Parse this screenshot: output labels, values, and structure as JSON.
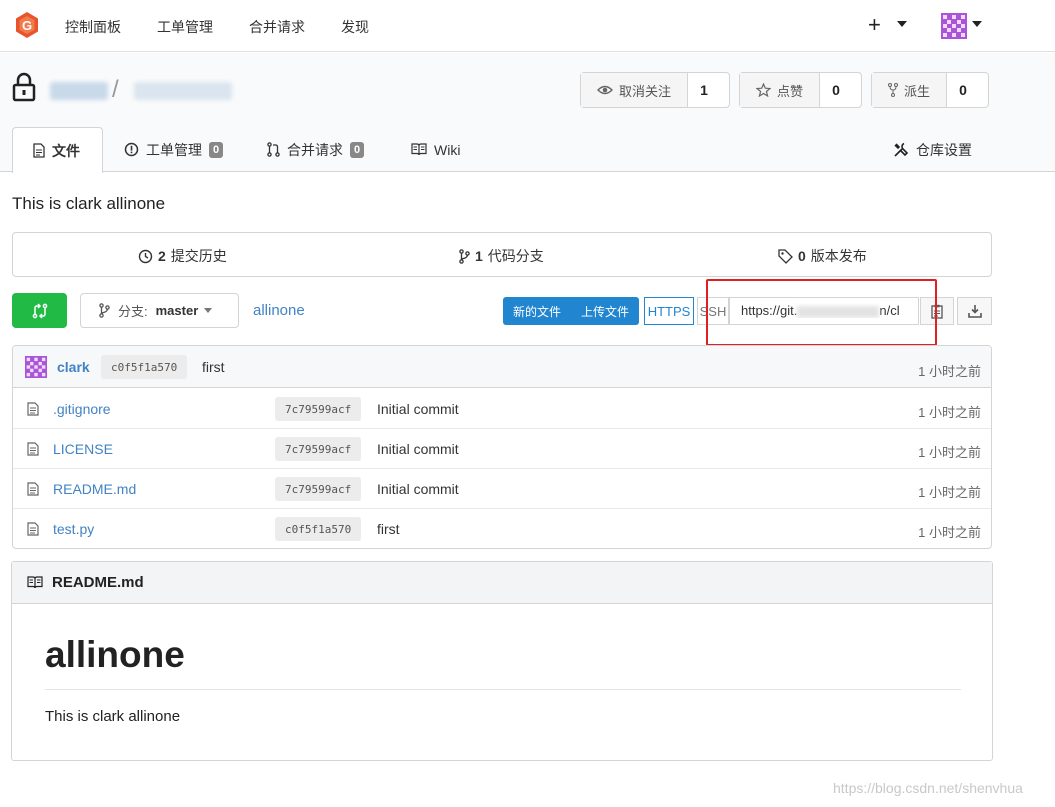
{
  "topnav": {
    "items": [
      "控制面板",
      "工单管理",
      "合并请求",
      "发现"
    ],
    "plus_label": "+"
  },
  "repo": {
    "owner_blurred": "",
    "separator": "/",
    "watch": {
      "label": "取消关注",
      "count": "1"
    },
    "star": {
      "label": "点赞",
      "count": "0"
    },
    "fork": {
      "label": "派生",
      "count": "0"
    }
  },
  "tabs": {
    "files": "文件",
    "issues": "工单管理",
    "issues_count": "0",
    "pulls": "合并请求",
    "pulls_count": "0",
    "wiki": "Wiki",
    "settings": "仓库设置"
  },
  "description": "This is clark allinone",
  "stats": {
    "commits_count": "2",
    "commits_label": "提交历史",
    "branches_count": "1",
    "branches_label": "代码分支",
    "releases_count": "0",
    "releases_label": "版本发布"
  },
  "toolbar": {
    "branch_prefix": "分支:",
    "branch_name": "master",
    "breadcrumb": "allinone",
    "new_file": "新的文件",
    "upload_file": "上传文件",
    "https": "HTTPS",
    "ssh": "SSH",
    "clone_url_start": "https://git.",
    "clone_url_end": "n/cl"
  },
  "latest_commit": {
    "author": "clark",
    "sha": "c0f5f1a570",
    "message": "first",
    "time": "1 小时之前"
  },
  "files": [
    {
      "name": ".gitignore",
      "sha": "7c79599acf",
      "message": "Initial commit",
      "time": "1 小时之前"
    },
    {
      "name": "LICENSE",
      "sha": "7c79599acf",
      "message": "Initial commit",
      "time": "1 小时之前"
    },
    {
      "name": "README.md",
      "sha": "7c79599acf",
      "message": "Initial commit",
      "time": "1 小时之前"
    },
    {
      "name": "test.py",
      "sha": "c0f5f1a570",
      "message": "first",
      "time": "1 小时之前"
    }
  ],
  "readme": {
    "filename": "README.md",
    "heading": "allinone",
    "body": "This is clark allinone"
  },
  "watermark": "https://blog.csdn.net/shenvhua",
  "colors": {
    "brand": "#e8542b",
    "link": "#4183c4",
    "primary": "#2185d0",
    "green": "#21ba45",
    "highlight": "#e02020"
  }
}
